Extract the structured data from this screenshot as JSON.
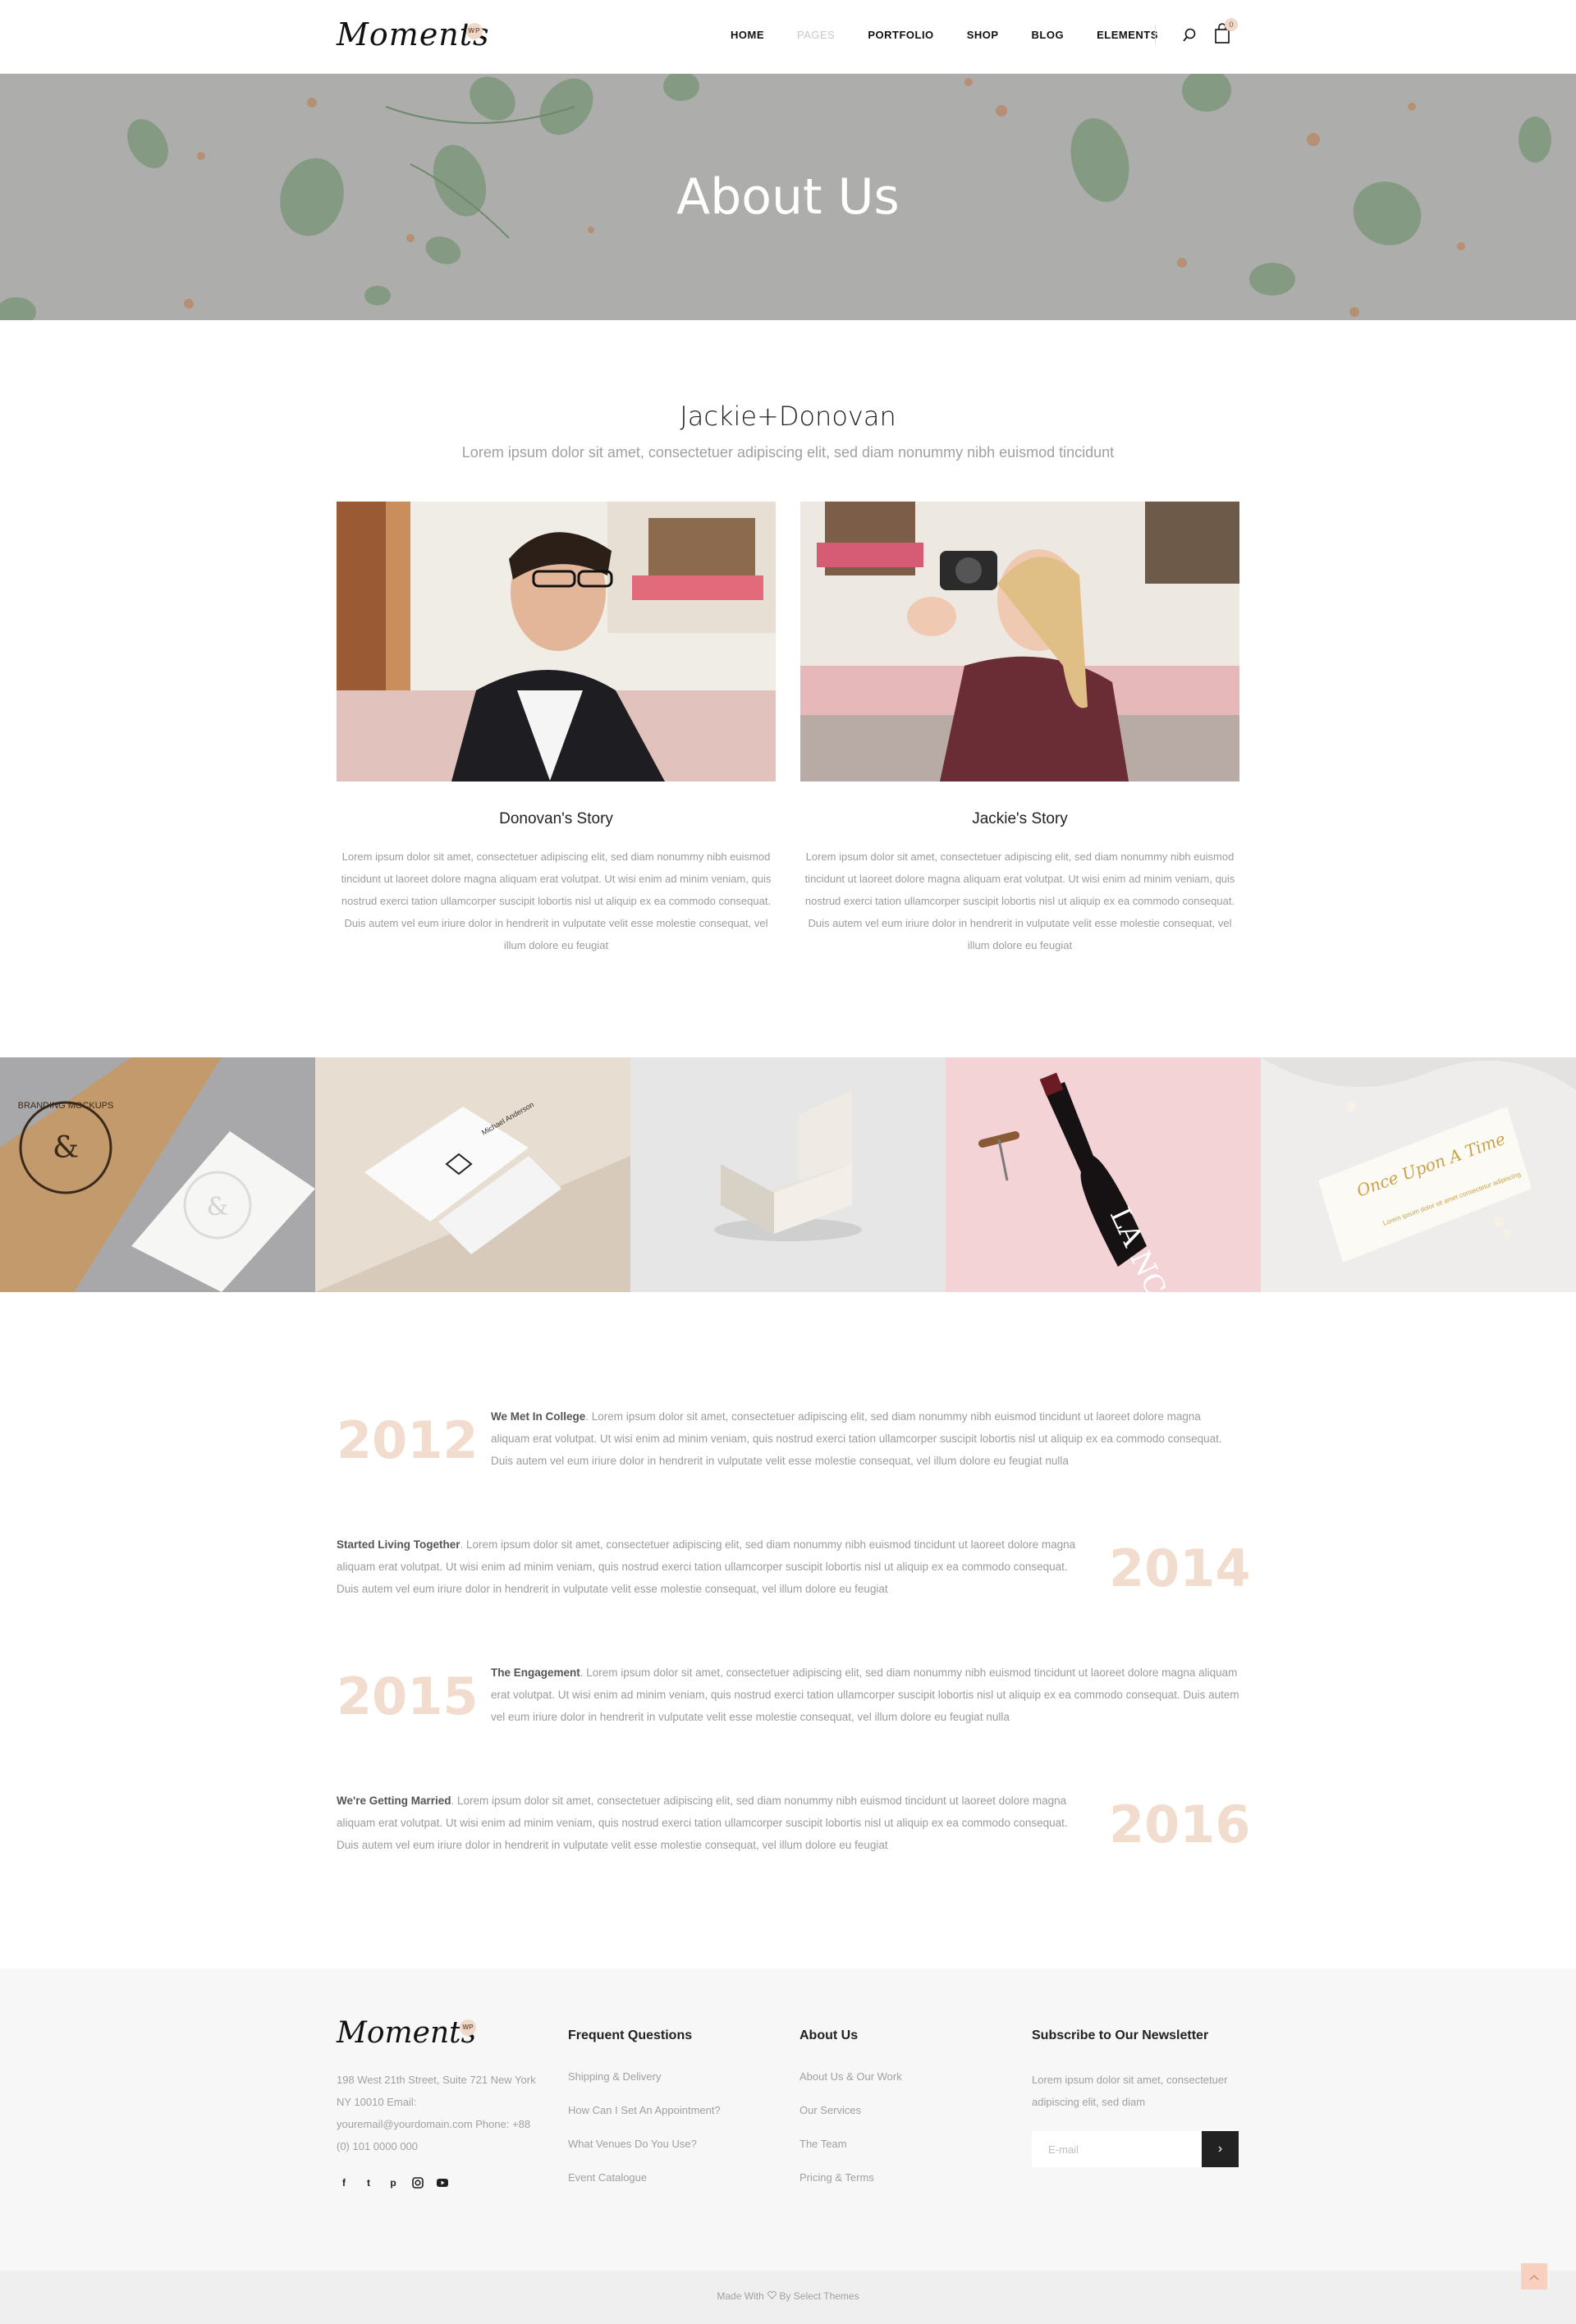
{
  "header": {
    "logo": "Moments",
    "logo_badge": "WP",
    "nav": [
      "HOME",
      "PAGES",
      "PORTFOLIO",
      "SHOP",
      "BLOG",
      "ELEMENTS"
    ],
    "active_nav": "PAGES",
    "cart_count": "0"
  },
  "hero": {
    "title": "About Us"
  },
  "intro": {
    "title": "Jackie+Donovan",
    "subtitle": "Lorem ipsum dolor sit amet, consectetuer adipiscing elit, sed diam nonummy nibh euismod tincidunt"
  },
  "stories": [
    {
      "title": "Donovan's Story",
      "text": "Lorem ipsum dolor sit amet, consectetuer adipiscing elit, sed diam nonummy nibh euismod tincidunt ut laoreet dolore magna aliquam erat volutpat. Ut wisi enim ad minim veniam, quis nostrud exerci tation ullamcorper suscipit lobortis nisl ut aliquip ex ea commodo consequat. Duis autem vel eum iriure dolor in hendrerit in vulputate velit esse molestie consequat, vel illum dolore eu feugiat"
    },
    {
      "title": "Jackie's Story",
      "text": "Lorem ipsum dolor sit amet, consectetuer adipiscing elit, sed diam nonummy nibh euismod tincidunt ut laoreet dolore magna aliquam erat volutpat. Ut wisi enim ad minim veniam, quis nostrud exerci tation ullamcorper suscipit lobortis nisl ut aliquip ex ea commodo consequat. Duis autem vel eum iriure dolor in hendrerit in vulputate velit esse molestie consequat, vel illum dolore eu feugiat"
    }
  ],
  "gallery": {
    "branding_text": "BRANDING MOCKUPS",
    "card_name": "Michael Anderson",
    "wine_label": "LA NC",
    "invite_title": "Once Upon A Time",
    "invite_sub": "Lorem ipsum dolor sit amet consectetur adipiscing"
  },
  "timeline": [
    {
      "year": "2012",
      "heading": "We Met In College",
      "text": ". Lorem ipsum dolor sit amet, consectetuer adipiscing elit, sed diam nonummy nibh euismod tincidunt ut laoreet dolore magna aliquam erat volutpat. Ut wisi enim ad minim veniam, quis nostrud exerci tation ullamcorper suscipit lobortis nisl ut aliquip ex ea commodo consequat. Duis autem vel eum iriure dolor in hendrerit in vulputate velit esse molestie consequat, vel illum dolore eu feugiat nulla"
    },
    {
      "year": "2014",
      "heading": "Started Living Together",
      "text": ". Lorem ipsum dolor sit amet, consectetuer adipiscing elit, sed diam nonummy nibh euismod tincidunt ut laoreet dolore magna aliquam erat volutpat. Ut wisi enim ad minim veniam, quis nostrud exerci tation ullamcorper suscipit lobortis nisl ut aliquip ex ea commodo consequat. Duis autem vel eum iriure dolor in hendrerit in vulputate velit esse molestie consequat, vel illum dolore eu feugiat"
    },
    {
      "year": "2015",
      "heading": "The Engagement",
      "text": ". Lorem ipsum dolor sit amet, consectetuer adipiscing elit, sed diam nonummy nibh euismod tincidunt ut laoreet dolore magna aliquam erat volutpat. Ut wisi enim ad minim veniam, quis nostrud exerci tation ullamcorper suscipit lobortis nisl ut aliquip ex ea commodo consequat. Duis autem vel eum iriure dolor in hendrerit in vulputate velit esse molestie consequat, vel illum dolore eu feugiat nulla"
    },
    {
      "year": "2016",
      "heading": "We're Getting Married",
      "text": ". Lorem ipsum dolor sit amet, consectetuer adipiscing elit, sed diam nonummy nibh euismod tincidunt ut laoreet dolore magna aliquam erat volutpat. Ut wisi enim ad minim veniam, quis nostrud exerci tation ullamcorper suscipit lobortis nisl ut aliquip ex ea commodo consequat. Duis autem vel eum iriure dolor in hendrerit in vulputate velit esse molestie consequat, vel illum dolore eu feugiat"
    }
  ],
  "footer": {
    "logo": "Moments",
    "logo_badge": "WP",
    "address": "198 West 21th Street, Suite 721 New York NY 10010 Email: youremail@yourdomain.com Phone: +88 (0) 101 0000 000",
    "social": [
      "facebook-icon",
      "twitter-icon",
      "pinterest-icon",
      "instagram-icon",
      "youtube-icon"
    ],
    "col1_title": "Frequent Questions",
    "col1_links": [
      "Shipping & Delivery",
      "How Can I Set An Appointment?",
      "What Venues Do You Use?",
      "Event Catalogue"
    ],
    "col2_title": "About Us",
    "col2_links": [
      "About Us & Our Work",
      "Our Services",
      "The Team",
      "Pricing & Terms"
    ],
    "col3_title": "Subscribe to Our Newsletter",
    "newsletter_text": "Lorem ipsum dolor sit amet, consectetuer adipiscing elit, sed diam",
    "email_placeholder": "E-mail",
    "submit_icon": "›"
  },
  "bottom": {
    "made_with": "Made With",
    "by": "By Select Themes"
  },
  "colors": {
    "accent": "#f2dccd",
    "badge": "#f0d8c8",
    "hero_bg": "#adaeab",
    "footer_bg": "#f7f7f7"
  }
}
